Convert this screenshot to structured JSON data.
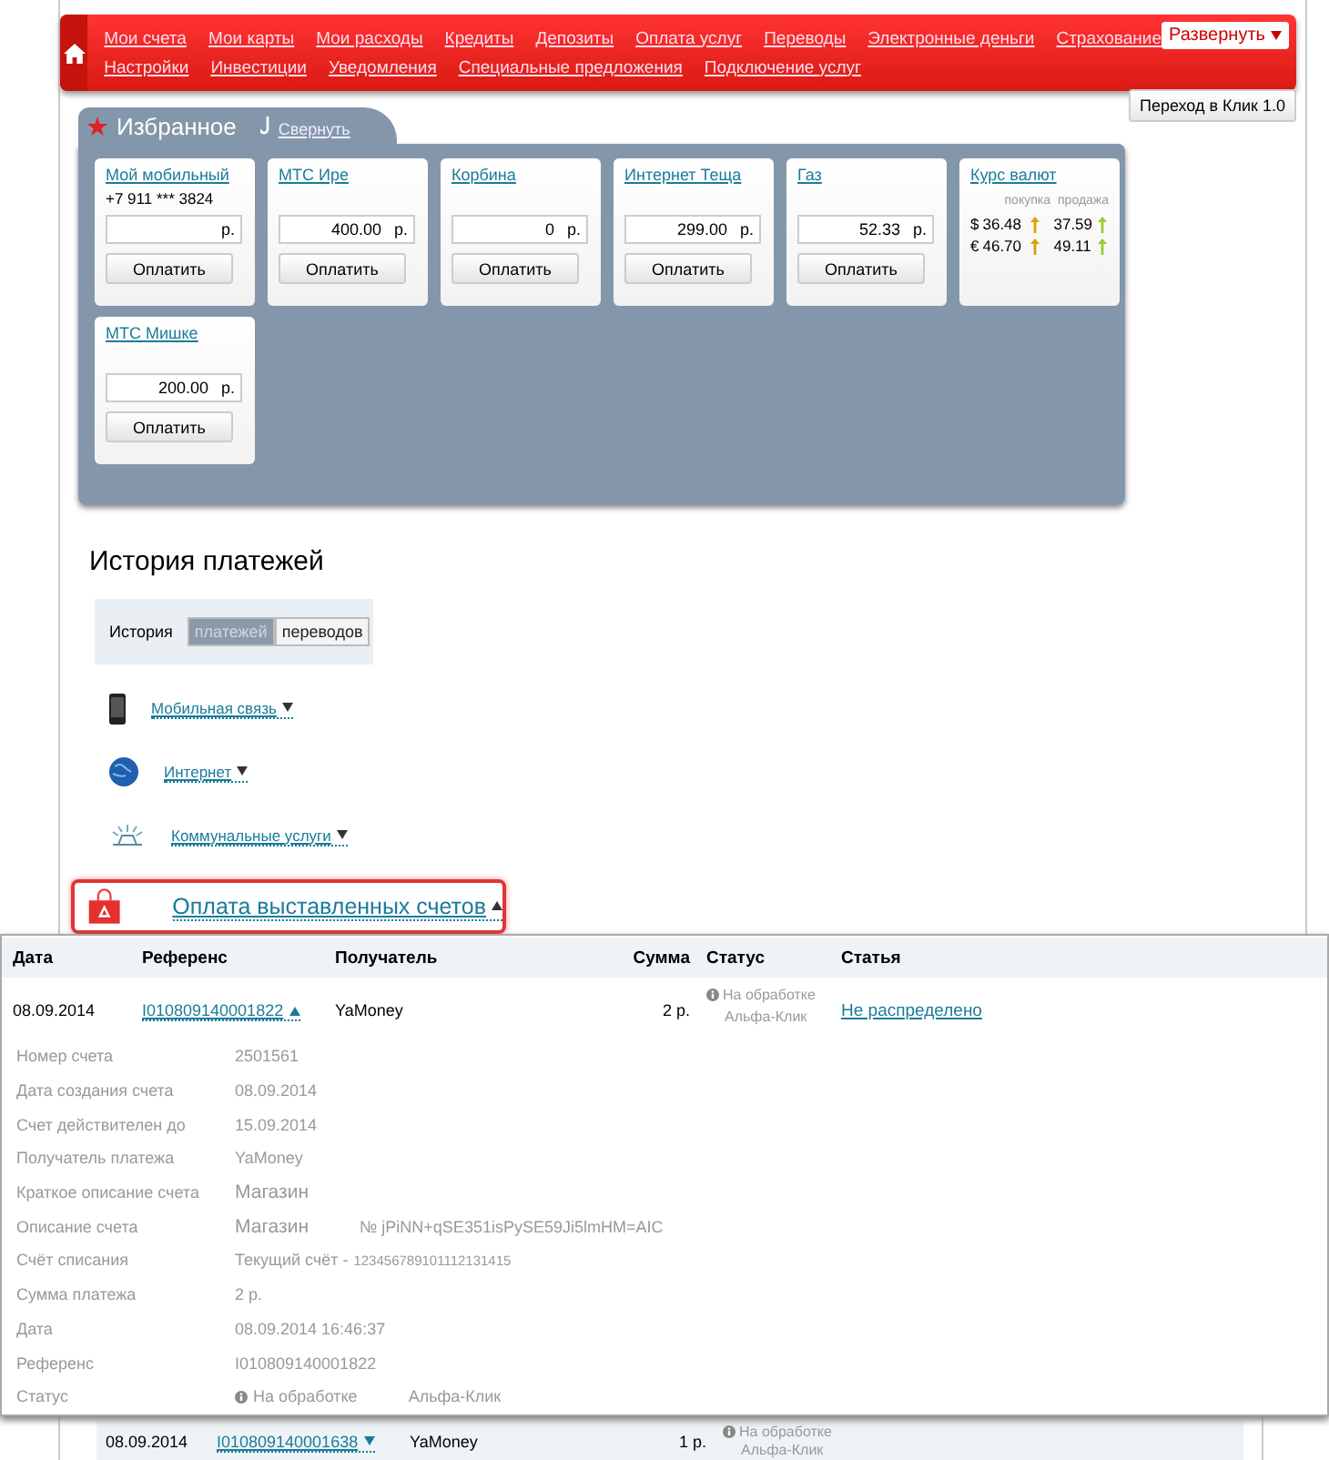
{
  "nav": {
    "primary_links": [
      "Мои счета",
      "Мои карты",
      "Мои расходы",
      "Кредиты",
      "Депозиты",
      "Оплата услуг",
      "Переводы",
      "Электронные деньги",
      "Страхование"
    ],
    "secondary_links": [
      "Настройки",
      "Инвестиции",
      "Уведомления",
      "Специальные предложения",
      "Подключение услуг"
    ],
    "expand_button": "Развернуть"
  },
  "switch_button": "Переход в Клик 1.0",
  "favorites": {
    "title": "Избранное",
    "collapse_link": "Свернуть",
    "cards": [
      {
        "kind": "payment",
        "name": "Мой мобильный",
        "phone": "+7 911 *** 3824",
        "unit": "р.",
        "button": "Оплатить"
      },
      {
        "kind": "payment",
        "name": "МТС Ире",
        "amount": "400.00",
        "unit": "р.",
        "button": "Оплатить"
      },
      {
        "kind": "payment",
        "name": "Корбина",
        "amount": "0",
        "unit": "р.",
        "button": "Оплатить"
      },
      {
        "kind": "payment",
        "name": "Интернет Теща",
        "amount": "299.00",
        "unit": "р.",
        "button": "Оплатить"
      },
      {
        "kind": "payment",
        "name": "Газ",
        "amount": "52.33",
        "unit": "р.",
        "button": "Оплатить"
      },
      {
        "kind": "rates",
        "name": "Курс валют",
        "headers": [
          "покупка",
          "продажа"
        ],
        "rows": [
          {
            "currency": "$",
            "buy": "36.48",
            "sell": "37.59"
          },
          {
            "currency": "€",
            "buy": "46.70",
            "sell": "49.11"
          }
        ]
      },
      {
        "kind": "payment",
        "name": "МТС Мишке",
        "amount": "200.00",
        "unit": "р.",
        "button": "Оплатить"
      }
    ]
  },
  "history": {
    "title": "История платежей",
    "tabs_label": "История",
    "tabs": [
      {
        "label": "платежей",
        "selected": true
      },
      {
        "label": "переводов",
        "selected": false
      }
    ],
    "categories": [
      {
        "kind": "phone",
        "label": "Мобильная связь",
        "expanded": false,
        "highlighted": false
      },
      {
        "kind": "globe",
        "label": "Интернет",
        "expanded": false,
        "highlighted": false
      },
      {
        "kind": "utilities",
        "label": "Коммунальные услуги",
        "expanded": false,
        "highlighted": false
      },
      {
        "kind": "bag",
        "label": "Оплата выставленных счетов",
        "expanded": true,
        "highlighted": true
      }
    ]
  },
  "table": {
    "columns": [
      "Дата",
      "Референс",
      "Получатель",
      "Сумма",
      "Статус",
      "Статья"
    ],
    "rows": [
      {
        "date": "08.09.2014",
        "reference": "I010809140001822",
        "recipient": "YaMoney",
        "amount": "2 р.",
        "status": [
          "На обработке",
          "Альфа-Клик"
        ],
        "article": "Не распределено",
        "expanded": true,
        "details": [
          {
            "label": "Номер счета",
            "value": "2501561"
          },
          {
            "label": "Дата создания счета",
            "value": "08.09.2014"
          },
          {
            "label": "Счет действителен до",
            "value": "15.09.2014"
          },
          {
            "label": "Получатель платежа",
            "value": "YaMoney"
          },
          {
            "label": "Краткое описание счета",
            "value": "Магазин",
            "kind": "large"
          },
          {
            "label": "Описание счета",
            "value": "Магазин",
            "extra": "№ jPiNN+qSE351isPySE59Ji5lmHM=AIC",
            "kind": "large"
          },
          {
            "label": "Счёт списания",
            "value": "Текущий счёт -",
            "extra": "123456789101112131415",
            "kind": "text"
          },
          {
            "label": "Сумма платежа",
            "value": "2 р.",
            "kind": "text"
          },
          {
            "label": "Дата",
            "value": "08.09.2014 16:46:37",
            "kind": "text"
          },
          {
            "label": "Референс",
            "value": "I010809140001822",
            "kind": "text"
          },
          {
            "label": "Статус",
            "value": "На обработке",
            "extra": "Альфа-Клик",
            "kind": "status"
          }
        ]
      },
      {
        "date": "08.09.2014",
        "reference": "I010809140001638",
        "recipient": "YaMoney",
        "amount": "1 р.",
        "status": [
          "На обработке",
          "Альфа-Клик"
        ],
        "expanded": false
      }
    ]
  }
}
